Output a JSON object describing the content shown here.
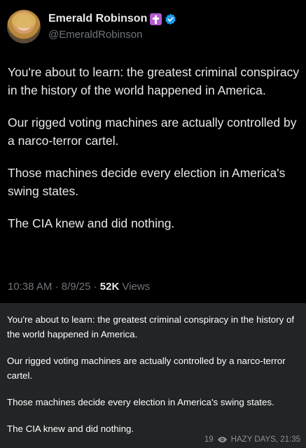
{
  "tweet": {
    "display_name": "Emerald Robinson",
    "handle": "@EmeraldRobinson",
    "icons": [
      "cross-icon",
      "verified-icon"
    ],
    "paragraphs": [
      "You're about to learn: the greatest criminal conspiracy in the history of the world happened in America.",
      "Our rigged voting machines are actually controlled by a narco-terror cartel.",
      "Those machines decide every election in America's swing states.",
      "The CIA knew and did nothing."
    ],
    "time": "10:38 AM",
    "date": "8/9/25",
    "views_count": "52K",
    "views_label": "Views",
    "separator": "·"
  },
  "caption": {
    "paragraphs": [
      "You're about to learn: the greatest criminal conspiracy in the history of the world happened in America.",
      "Our rigged voting machines are actually controlled by a narco-terror cartel.",
      "Those machines decide every election in America's swing states.",
      "The CIA knew and did nothing."
    ],
    "view_count": "19",
    "channel_time": "HAZY DAYS, 21:35"
  },
  "colors": {
    "background": "#000000",
    "text": "#e7e9ea",
    "muted": "#71767b",
    "verified": "#1d9bf0",
    "cross_badge": "#b45bd6",
    "caption_bg": "#222425"
  }
}
